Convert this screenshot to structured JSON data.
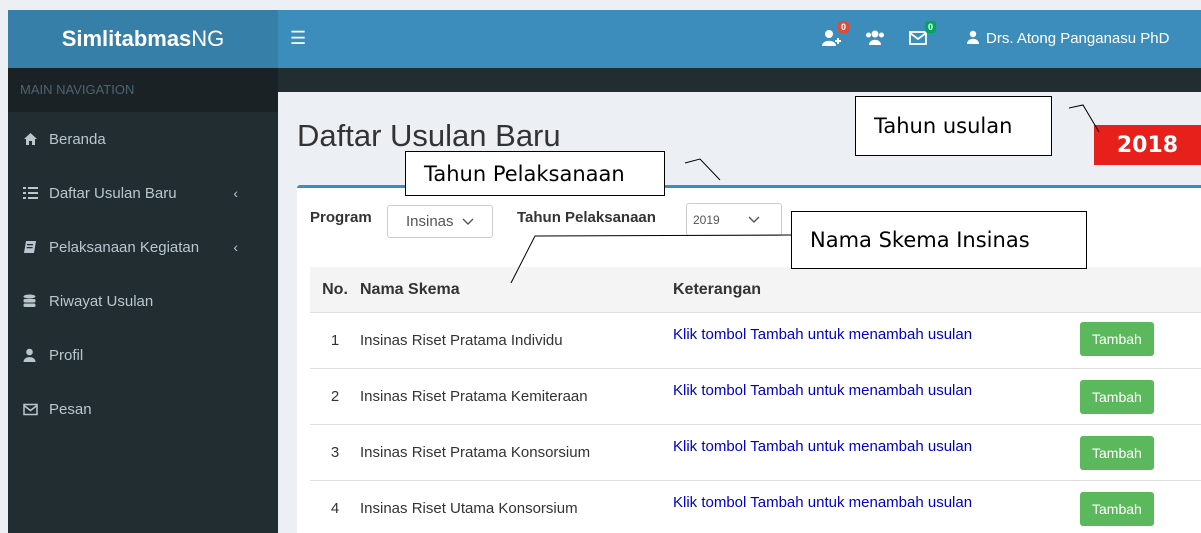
{
  "app": {
    "brand_bold": "Simlitabmas",
    "brand_rest": "NG"
  },
  "header": {
    "notif_count": "0",
    "mail_count": "0",
    "user_name": "Drs. Atong Panganasu PhD"
  },
  "sidebar": {
    "header": "MAIN NAVIGATION",
    "items": [
      {
        "label": "Beranda",
        "icon": "home-icon"
      },
      {
        "label": "Daftar Usulan Baru",
        "icon": "list-icon",
        "has_chevron": true
      },
      {
        "label": "Pelaksanaan Kegiatan",
        "icon": "book-icon",
        "has_chevron": true
      },
      {
        "label": "Riwayat Usulan",
        "icon": "database-icon"
      },
      {
        "label": "Profil",
        "icon": "user-icon"
      },
      {
        "label": "Pesan",
        "icon": "envelope-icon"
      }
    ]
  },
  "main": {
    "title": "Daftar Usulan Baru",
    "filters": {
      "program_label": "Program",
      "program_value": "Insinas",
      "tahun_label": "Tahun Pelaksanaan",
      "tahun_value": "2019"
    },
    "table": {
      "headers": [
        "No.",
        "Nama Skema",
        "Keterangan"
      ],
      "rows": [
        {
          "no": "1",
          "nama": "Insinas Riset Pratama Individu",
          "ket": "Klik tombol Tambah untuk menambah usulan",
          "action": "Tambah"
        },
        {
          "no": "2",
          "nama": "Insinas Riset Pratama Kemiteraan",
          "ket": "Klik tombol Tambah untuk menambah usulan",
          "action": "Tambah"
        },
        {
          "no": "3",
          "nama": "Insinas Riset Pratama Konsorsium",
          "ket": "Klik tombol Tambah untuk menambah usulan",
          "action": "Tambah"
        },
        {
          "no": "4",
          "nama": "Insinas Riset Utama Konsorsium",
          "ket": "Klik tombol Tambah untuk menambah usulan",
          "action": "Tambah"
        }
      ]
    }
  },
  "annotations": {
    "tahun_usulan": "Tahun usulan",
    "tahun_usulan_value": "2018",
    "tahun_pelaksanaan": "Tahun Pelaksanaan",
    "nama_skema": "Nama Skema Insinas"
  },
  "colors": {
    "header_blue": "#3c8dbc",
    "logo_blue": "#367fa9",
    "sidebar_dark": "#222d32",
    "button_green": "#5cb85c",
    "link_blue": "#0000cc",
    "year_red": "#e8201c"
  }
}
